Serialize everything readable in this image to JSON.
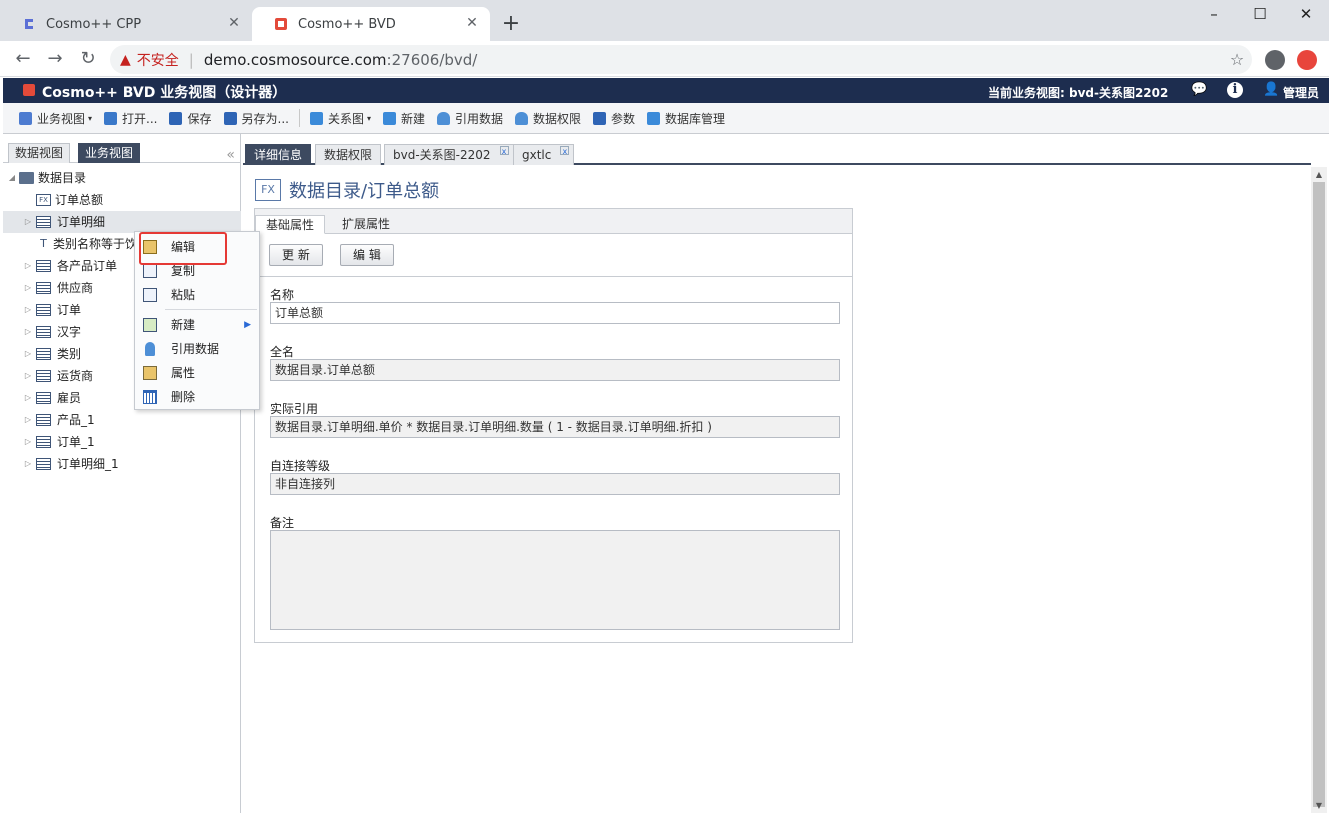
{
  "browser": {
    "tabs": [
      {
        "title": "Cosmo++ CPP",
        "close": "✕"
      },
      {
        "title": "Cosmo++ BVD",
        "close": "✕"
      }
    ],
    "new_tab": "+",
    "window": {
      "minimize": "–",
      "maximize": "☐",
      "close": "✕"
    },
    "nav": {
      "back": "←",
      "forward": "→",
      "reload": "↻"
    },
    "security_warning_icon": "▲",
    "security_text": "不安全",
    "url_host": "demo.cosmosource.com",
    "url_path": ":27606/bvd/",
    "star": "☆"
  },
  "app": {
    "title": "Cosmo++ BVD 业务视图（设计器）",
    "current_view": "当前业务视图: bvd-关系图2202",
    "user": "管理员",
    "chat_icon": "💬",
    "info_icon": "i",
    "user_icon": "👤"
  },
  "toolbar": {
    "items": [
      "业务视图",
      "打开...",
      "保存",
      "另存为...",
      "关系图",
      "新建",
      "引用数据",
      "数据权限",
      "参数",
      "数据库管理"
    ],
    "caret": "▾"
  },
  "left_panel": {
    "tabs": [
      "数据视图",
      "业务视图"
    ],
    "collapse": "«",
    "tree": {
      "root": "数据目录",
      "children": [
        "订单总额",
        "订单明细",
        "类别名称等于饮",
        "各产品订单",
        "供应商",
        "订单",
        "汉字",
        "类别",
        "运货商",
        "雇员",
        "产品_1",
        "订单_1",
        "订单明细_1"
      ]
    },
    "arrow_collapsed": "▷",
    "arrow_expanded": "◢",
    "fx": "FX",
    "filter": "T"
  },
  "context_menu": {
    "items": [
      "编辑",
      "复制",
      "粘贴",
      "新建",
      "引用数据",
      "属性",
      "删除"
    ],
    "submenu_arrow": "▶"
  },
  "right_tabs": [
    {
      "label": "详细信息"
    },
    {
      "label": "数据权限"
    },
    {
      "label": "bvd-关系图-2202",
      "close": "x"
    },
    {
      "label": "gxtlc",
      "close": "x"
    }
  ],
  "detail": {
    "icon": "FX",
    "title": "数据目录/订单总额",
    "tabs": [
      "基础属性",
      "扩展属性"
    ],
    "buttons": {
      "update": "更 新",
      "edit": "编 辑"
    },
    "fields": {
      "name_label": "名称",
      "name_value": "订单总额",
      "fullname_label": "全名",
      "fullname_value": "数据目录.订单总额",
      "ref_label": "实际引用",
      "ref_value": "数据目录.订单明细.单价 * 数据目录.订单明细.数量 ( 1 - 数据目录.订单明细.折扣 )",
      "selfjoin_label": "自连接等级",
      "selfjoin_value": "非自连接列",
      "note_label": "备注",
      "note_value": ""
    }
  },
  "scrollbar": {
    "up": "▲",
    "down": "▼"
  },
  "colors": {
    "header_bg": "#1d2d4f",
    "active_tab": "#3d4a60",
    "highlight": "#e53935",
    "brand": "#e34a3a"
  }
}
